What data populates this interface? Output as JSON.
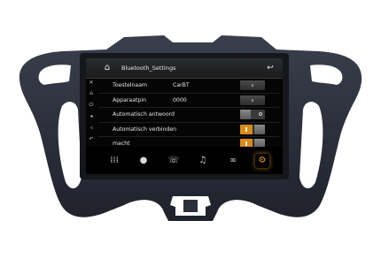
{
  "colors": {
    "bezel": "#2b2f3a",
    "screen_bg": "#050505",
    "accent": "#e89a2a",
    "text": "#e6e6e6"
  },
  "header": {
    "home_icon": "home-icon",
    "title": "Bluetooth_Settings",
    "back_icon": "back-arrow-icon"
  },
  "sidebar_icons": [
    "close-icon",
    "home-icon",
    "power-icon",
    "volume-up-icon",
    "volume-down-icon",
    "back-icon"
  ],
  "rows": [
    {
      "label": "Toestelnaam",
      "value": "CarBT",
      "control": "arrow"
    },
    {
      "label": "Apparaatpin",
      "value": "0000",
      "control": "arrow"
    },
    {
      "label": "Automatisch antwoord",
      "value": "",
      "control": "toggle",
      "state": "off"
    },
    {
      "label": "Automatisch verbinden",
      "value": "",
      "control": "toggle",
      "state": "on"
    },
    {
      "label": "macht",
      "value": "",
      "control": "toggle",
      "state": "on"
    }
  ],
  "dock": [
    {
      "name": "dialpad-icon",
      "glyph": "⣿",
      "active": false
    },
    {
      "name": "contacts-icon",
      "glyph": "👤",
      "active": false
    },
    {
      "name": "call-log-icon",
      "glyph": "☎",
      "active": false
    },
    {
      "name": "music-icon",
      "glyph": "♫",
      "active": false
    },
    {
      "name": "link-icon",
      "glyph": "⚭",
      "active": false
    },
    {
      "name": "settings-icon",
      "glyph": "⚙",
      "active": true
    }
  ]
}
